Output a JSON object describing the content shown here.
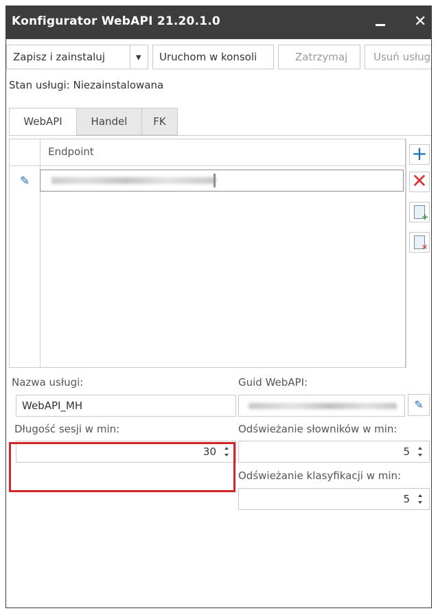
{
  "window": {
    "title": "Konfigurator WebAPI 21.20.1.0",
    "minimize_glyph": "—",
    "close_glyph": "✕"
  },
  "toolbar": {
    "install": "Zapisz i zainstaluj",
    "dropdown_glyph": "▾",
    "run_console": "Uruchom w konsoli",
    "stop": "Zatrzymaj",
    "remove": "Usuń usługę"
  },
  "status": {
    "text": "Stan usługi: Niezainstalowana"
  },
  "tabs": [
    {
      "label": "WebAPI"
    },
    {
      "label": "Handel"
    },
    {
      "label": "FK"
    }
  ],
  "grid": {
    "column": "Endpoint",
    "edit_icon": "pencil-icon"
  },
  "side_buttons": {
    "add": "+",
    "delete": "✕"
  },
  "form": {
    "service_name_label": "Nazwa usługi:",
    "service_name_value": "WebAPI_MH",
    "guid_label": "Guid WebAPI:",
    "session_label": "Długość sesji w min:",
    "session_value": "30",
    "dict_refresh_label": "Odświeżanie słowników w min:",
    "dict_refresh_value": "5",
    "class_refresh_label": "Odświeżanie klasyfikacji w min:",
    "class_refresh_value": "5"
  },
  "colors": {
    "titlebar": "#3d3d3d",
    "accent": "#1f6fb5",
    "highlight": "#d3242a"
  }
}
